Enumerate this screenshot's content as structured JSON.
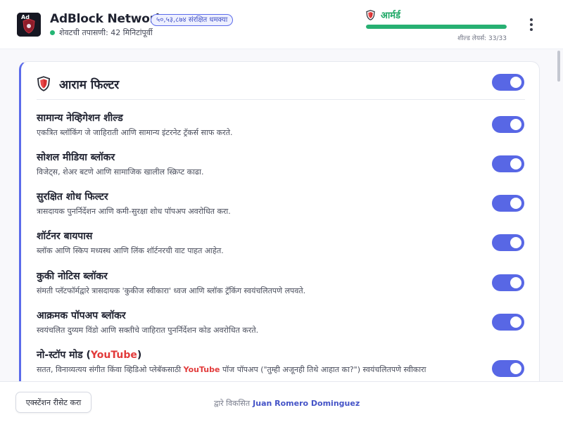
{
  "header": {
    "app_title": "AdBlock Network",
    "threat_badge": "५०,५३,८७४ संरक्षित धमक्या",
    "last_check": "शेवटची तपासणी: 42 मिनिटांपूर्वी",
    "status_label": "आर्मर्ड",
    "shield_layers": "शील्ड लेयर्स: 33/33",
    "shield_progress": 1.0,
    "logo_text": "Ad"
  },
  "colors": {
    "accent": "#5867e5",
    "armed_green": "#1ea866",
    "shield_red": "#d63030"
  },
  "card": {
    "title": "आराम फिल्टर",
    "enabled": true
  },
  "filters": [
    {
      "title": "सामान्य नेव्हिगेशन शील्ड",
      "desc": "एकत्रित ब्लॉकिंग जे जाहिराती आणि सामान्य इंटरनेट ट्रॅकर्स साफ करते.",
      "enabled": true
    },
    {
      "title": "सोशल मीडिया ब्लॉकर",
      "desc": "विजेट्स, शेअर बटणे आणि सामाजिक खालील स्क्रिप्ट काढा.",
      "enabled": true
    },
    {
      "title": "सुरक्षित शोध फिल्टर",
      "desc": "त्रासदायक पुनर्निर्देशन आणि कमी-सुरक्षा शोध पॉपअप अवरोधित करा.",
      "enabled": true
    },
    {
      "title": "शॉर्टनर बायपास",
      "desc": "ब्लॉक आणि स्किप मध्यस्थ आणि लिंक शॉर्टनरची वाट पाहत आहेत.",
      "enabled": true
    },
    {
      "title": "कुकी नोटिस ब्लॉकर",
      "desc": "संमती प्लॅटफॉर्मद्वारे त्रासदायक 'कुकीज स्वीकारा' ध्वज आणि ब्लॉक ट्रॅकिंग स्वयंचलितपणे लपवते.",
      "enabled": true
    },
    {
      "title": "आक्रमक पॉपअप ब्लॉकर",
      "desc": "स्वयंचलित दुय्यम विंडो आणि सक्तीचे जाहिरात पुनर्निर्देशन कोड अवरोधित करते.",
      "enabled": true
    }
  ],
  "nonstop": {
    "title_prefix": "नो-स्टॉप मोड (",
    "yt_you": "You",
    "yt_tube": "Tube",
    "title_suffix": ")",
    "desc_prefix": "सतत, विनाव्यत्यय संगीत किंवा व्हिडिओ प्लेबॅकसाठी ",
    "desc_suffix": " पॉज पॉपअप (\"तुम्ही अजूनही तिथे आहात का?\") स्वयंचलितपणे स्वीकारा",
    "enabled": true
  },
  "footer": {
    "reset_label": "एक्स्टेंशन रीसेट करा",
    "credit_prefix": "द्वारे विकसित",
    "author": "Juan Romero Dominguez"
  }
}
